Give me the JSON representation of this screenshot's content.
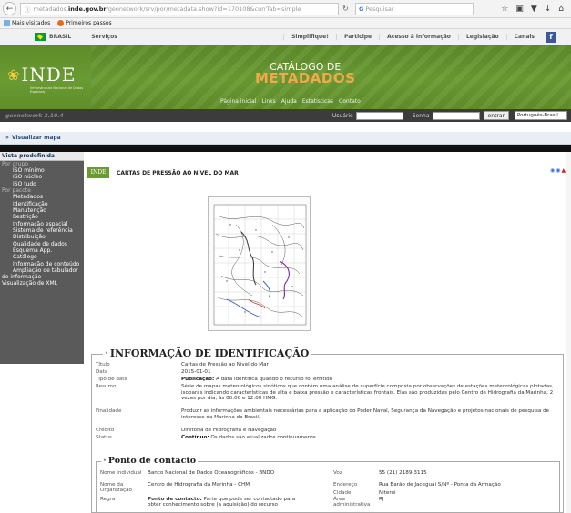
{
  "browser": {
    "url_prefix": "metadados.",
    "url_host": "inde.gov.br",
    "url_rest": "/geonetwork/srv/por/metadata.show?id=170108&currTab=simple",
    "search_placeholder": "Pesquisar",
    "bookmarks": [
      {
        "label": "Mais visitados"
      },
      {
        "label": "Primeiros passos"
      }
    ]
  },
  "govbar": {
    "brasil": "BRASIL",
    "servicos": "Serviços",
    "links": [
      "Simplifique!",
      "Participe",
      "Acesso à informação",
      "Legislação",
      "Canais"
    ]
  },
  "banner": {
    "logo": "INDE",
    "logo_sub": "Infraestrutura Nacional de Dados Espaciais",
    "title_line1": "CATÁLOGO DE",
    "title_line2": "METADADOS",
    "links": [
      "Página inicial",
      "Links",
      "Ajuda",
      "Estatísticas",
      "Contato"
    ]
  },
  "login": {
    "geonetwork": "geonetwork 2.10.4",
    "user_label": "Usuário",
    "password_label": "Senha",
    "submit": "entrar",
    "language": "Português-Brasil"
  },
  "mapstrip": {
    "label": "Visualizar mapa"
  },
  "sidebar": {
    "heading": "Vista predefinida",
    "group_standard": "Por grupo",
    "items_standard": [
      "ISO mínimo",
      "ISO núcleo",
      "ISO tudo"
    ],
    "group_package": "Por pacote",
    "items_package": [
      "Metadados",
      "Identificação",
      "Manutenção",
      "Restrição",
      "Informação espacial",
      "Sistema de referência",
      "Distribuição",
      "Qualidade de dados",
      "Esquema App.",
      "Catálogo",
      "Informação de conteúdo",
      "Ampliação de tabulador de informação"
    ],
    "xml": "Visualização de XML"
  },
  "document": {
    "logo": "INDE",
    "title": "CARTAS DE PRESSÃO AO NÍVEL DO MAR"
  },
  "identification": {
    "legend": "INFORMAÇÃO DE IDENTIFICAÇÃO",
    "rows": [
      {
        "key": "Título",
        "value": "Cartas de Pressão ao Nível do Mar"
      },
      {
        "key": "Data",
        "value": "2015-01-01"
      },
      {
        "key": "Tipo de data",
        "value_bold": "Publicação:",
        "value": " A data identifica quando o recurso foi emitido"
      },
      {
        "key": "Resumo",
        "value": "Série de mapas meteorológicos sinóticos que contêm uma análise de superfície composta por observações de estações meteorológicas plotadas, isobaras indicando características de alta e baixa pressão e características frontais. Elas são produzidas pelo Centro de Hidrografia da Marinha, 2 vezes por dia, às 00:00 e 12:00 HMG."
      },
      {
        "key": "Finalidade",
        "value": "Produzir as informações ambientais necessárias para a aplicação do Poder Naval, Segurança da Navegação e projetos nacionais de pesquisa de interesse da Marinha do Brasil."
      },
      {
        "key": "Crédito",
        "value": "Diretoria de Hidrografia e Navegação"
      },
      {
        "key": "Status",
        "value_bold": "Contínuo:",
        "value": " Os dados são atualizados continuamente"
      }
    ]
  },
  "contact": {
    "legend": "Ponto de contacto",
    "individual_key": "Nome individual",
    "individual_value": "Banco Nacional de Dados Oceanográficos - BNDO",
    "org_key": "Nome da Organização",
    "org_value": "Centro de Hidrografia da Marinha - CHM",
    "role_key": "Regra",
    "role_bold": "Ponto de contacto:",
    "role_value": " Parte que pode ser contactado para obter conhecimento sobre (a aquisição) do recurso",
    "voice_key": "Voz",
    "voice_value": "55 (21) 2189-3115",
    "address_key": "Endereço",
    "address_value": "Rua Barão de Jaceguai S/Nº - Ponta da Armação",
    "city_key": "Cidade",
    "city_value": "Niterói",
    "area_key": "Área administrativa",
    "area_value": "RJ"
  }
}
